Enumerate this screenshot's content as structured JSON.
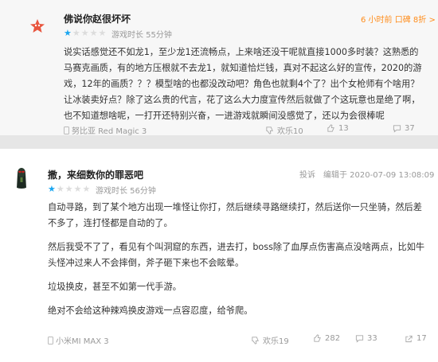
{
  "review1": {
    "username": "佛说你赵很坏坏",
    "rating": 1,
    "stars": [
      "★",
      "★",
      "★",
      "★",
      "★"
    ],
    "playtime": "游戏时长 55分钟",
    "time_ago": "6 小时前",
    "badge": "口碑 8折 >",
    "text": "说实话感觉还不如龙1，至少龙1还流畅点，上来啥还没干呢就直接1000多时装？这熟悉的马赛克画质，有的地方压根就不去龙1，就知道恰烂钱，真对不起这么好的宣传，2020的游戏，12年的画质？？？模型啥的也都没改动吧？角色也就剩4个了？出个女枪师有个啥用？让冰装卖好点？除了这么贵的代言，花了这么大力度宣传然后就做了个这玩意也是绝了啊，也不知道想啥呢，一打开还特别兴奋，一进游戏就瞬间没感觉了，还以为会很棒呢",
    "device": "努比亚 Red Magic 3",
    "dislike": "欢乐10",
    "likes": "13",
    "replies": "37"
  },
  "review2": {
    "username": "撒，来细数你的罪恶吧",
    "rating": 1,
    "stars": [
      "★",
      "★",
      "★",
      "★",
      "★"
    ],
    "playtime": "游戏时长 56分钟",
    "report": "投诉",
    "datetime": "编辑于 2020-07-09 13:08:09",
    "paragraphs": [
      "自动寻路，到了某个地方出现一堆怪让你打，然后继续寻路继续打，然后送你一只坐骑，然后差不多了，连打怪都是自动的了。",
      "然后我受不了了，看见有个叫洞窟的东西，进去打，boss除了血厚点伤害高点没啥两点，比如牛头怪冲过来人不会摔倒，斧子砸下来也不会眩晕。",
      "垃圾换皮，甚至不如第一代手游。",
      "绝对不会给这种辣鸡换皮游戏一点容忍度，给爷爬。"
    ],
    "device": "小米MI MAX 3",
    "dislike": "欢乐19",
    "likes": "282",
    "replies": "33",
    "shares": "17"
  }
}
